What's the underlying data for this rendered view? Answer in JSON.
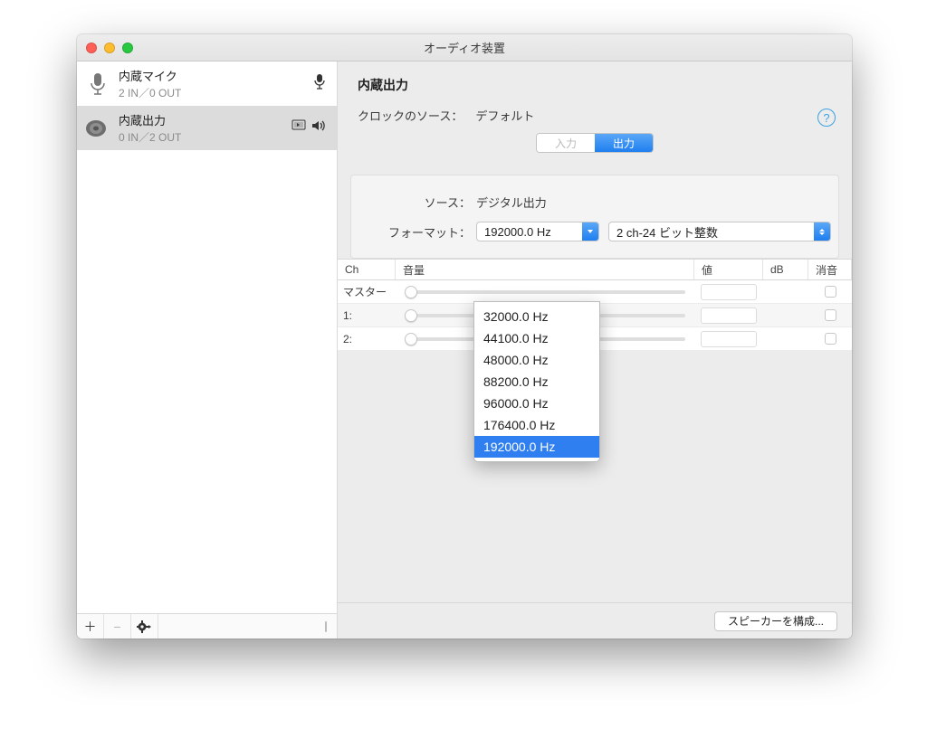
{
  "window": {
    "title": "オーディオ装置"
  },
  "sidebar": {
    "devices": [
      {
        "name": "内蔵マイク",
        "io": "2 IN／0 OUT",
        "kind": "mic",
        "selected": false,
        "badge_mic": true
      },
      {
        "name": "内蔵出力",
        "io": "0 IN／2 OUT",
        "kind": "speaker",
        "selected": true,
        "badge_system": true,
        "badge_volume": true
      }
    ],
    "footer": {
      "add": "+",
      "remove": "−",
      "gear": "✱"
    }
  },
  "main": {
    "device_title": "内蔵出力",
    "clock_label": "クロックのソース：",
    "clock_value": "デフォルト",
    "help": "?",
    "tabs": {
      "input": "入力",
      "output": "出力",
      "active": "output"
    },
    "panel": {
      "source_label": "ソース：",
      "source_value": "デジタル出力",
      "format_label": "フォーマット：",
      "sample_rate": "192000.0 Hz",
      "bit_depth": "2 ch-24 ビット整数",
      "rate_options": [
        "32000.0 Hz",
        "44100.0 Hz",
        "48000.0 Hz",
        "88200.0 Hz",
        "96000.0 Hz",
        "176400.0 Hz",
        "192000.0 Hz"
      ],
      "rate_selected": "192000.0 Hz"
    },
    "table": {
      "headers": {
        "ch": "Ch",
        "vol": "音量",
        "val": "値",
        "db": "dB",
        "mute": "消音"
      },
      "rows": [
        {
          "ch": "マスター"
        },
        {
          "ch": "1:"
        },
        {
          "ch": "2:"
        }
      ]
    },
    "footer_button": "スピーカーを構成..."
  }
}
